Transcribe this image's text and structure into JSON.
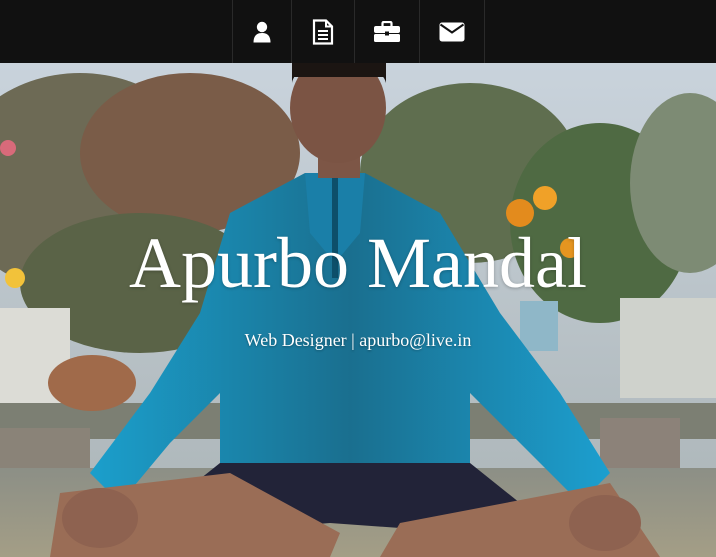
{
  "nav": {
    "items": [
      {
        "icon": "user-icon"
      },
      {
        "icon": "document-icon"
      },
      {
        "icon": "briefcase-icon"
      },
      {
        "icon": "envelope-icon"
      }
    ]
  },
  "hero": {
    "title": "Apurbo Mandal",
    "subtitle": "Web Designer | apurbo@live.in"
  },
  "colors": {
    "nav_background": "#111111",
    "icon": "#ffffff",
    "hero_text": "#ffffff"
  }
}
